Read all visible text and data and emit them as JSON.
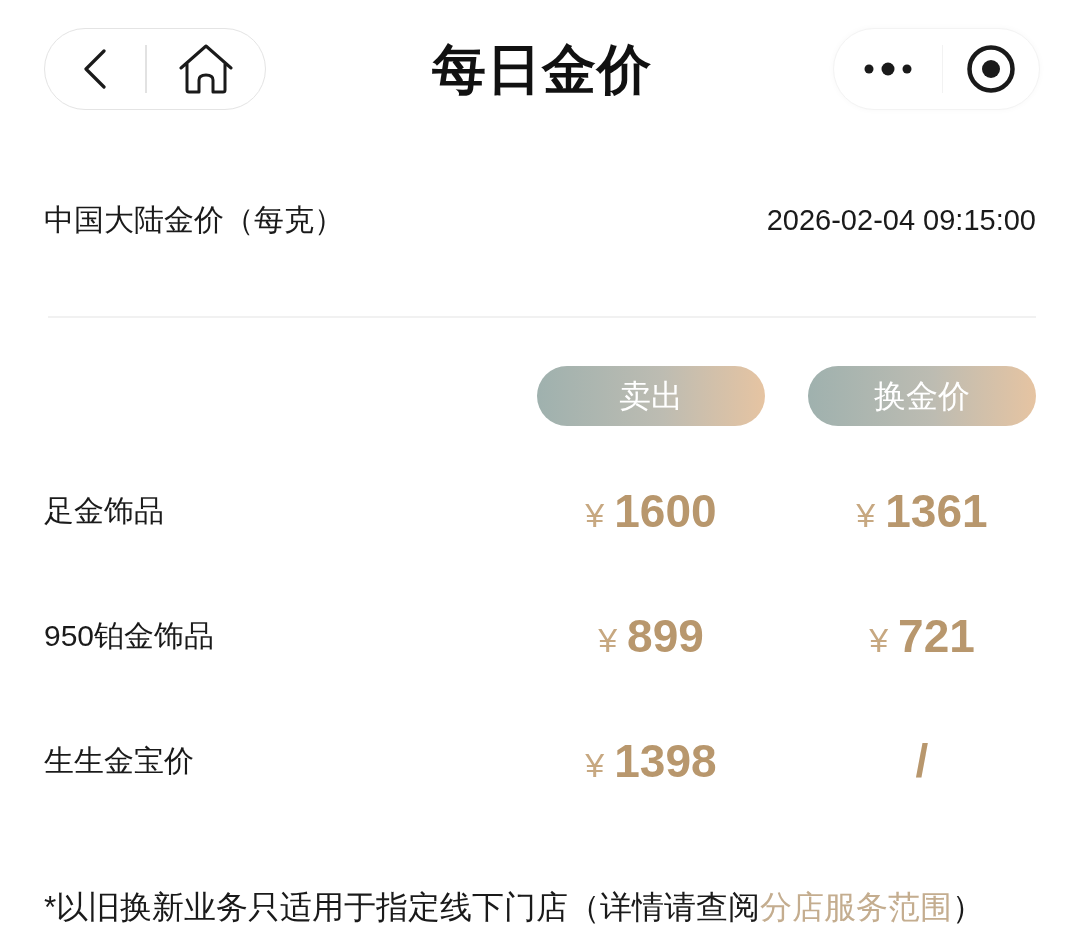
{
  "nav_bar": {
    "title": "每日金价"
  },
  "price_header": {
    "region": "中国大陆金价（每克）",
    "updated_at": "2026-02-04 09:15:00"
  },
  "columns": [
    "卖出",
    "换金价"
  ],
  "rows": [
    {
      "name": "足金饰品",
      "prices": [
        {
          "currency": "¥",
          "amount": "1600"
        },
        {
          "currency": "¥",
          "amount": "1361"
        }
      ]
    },
    {
      "name": "950铂金饰品",
      "prices": [
        {
          "currency": "¥",
          "amount": "899"
        },
        {
          "currency": "¥",
          "amount": "721"
        }
      ]
    },
    {
      "name": "生生金宝价",
      "prices": [
        {
          "currency": "¥",
          "amount": "1398"
        },
        {
          "amount": "/"
        }
      ]
    }
  ],
  "footnote": {
    "text": "*以旧换新业务只适用于指定线下门店（详情请查阅",
    "link": "分店服务范围",
    "text_after": "）"
  }
}
